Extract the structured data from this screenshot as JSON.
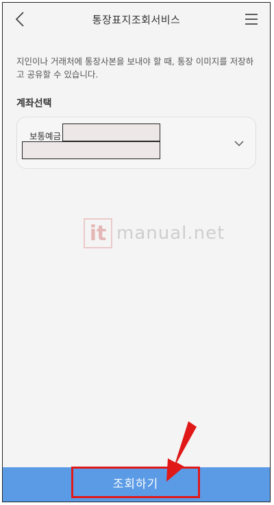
{
  "header": {
    "title": "통장표지조회서비스",
    "back_icon": "chevron-left-icon",
    "menu_icon": "hamburger-menu-icon"
  },
  "description": "지인이나 거래처에 통장사본을 보내야 할 때, 통장 이미지를 저장하고 공유할 수 있습니다.",
  "account_section": {
    "label": "계좌선택",
    "account_type": "보통예금",
    "dropdown_icon": "chevron-down-icon"
  },
  "watermark": {
    "logo": "it",
    "text": "manual.net"
  },
  "footer": {
    "submit_label": "조회하기",
    "color": "#5b9be6"
  },
  "annotation": {
    "arrow_color": "#e01818"
  }
}
